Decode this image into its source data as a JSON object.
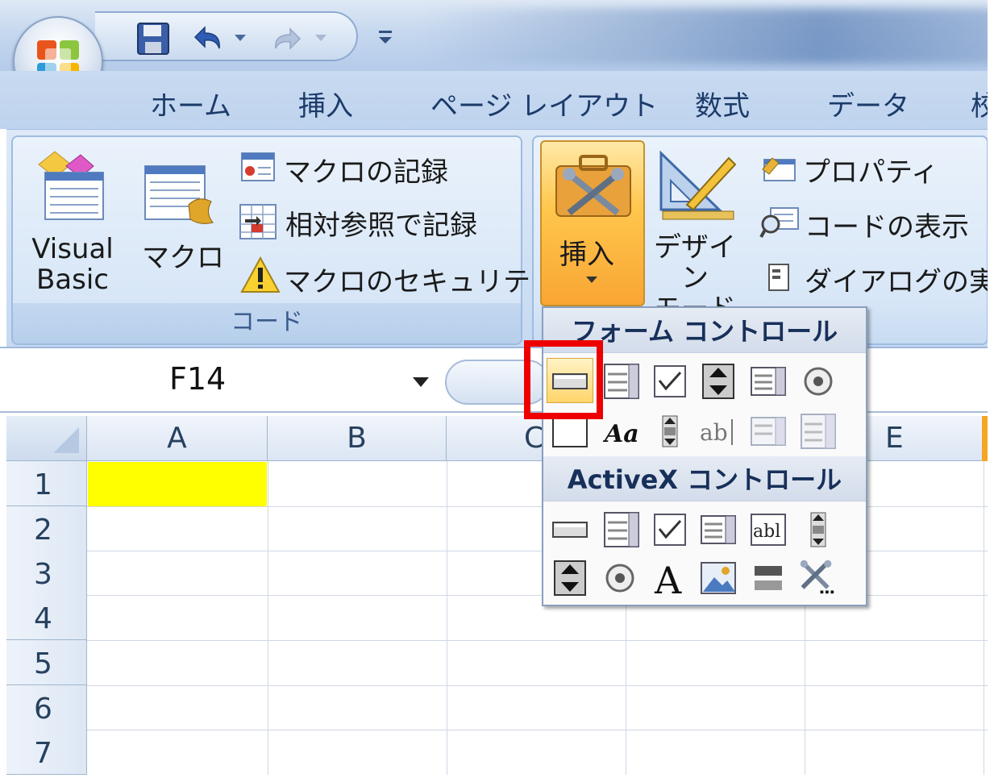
{
  "ribbon_tabs": [
    "ホーム",
    "挿入",
    "ページ レイアウト",
    "数式",
    "データ",
    "校"
  ],
  "code_group": {
    "label": "コード",
    "visual_basic": "Visual\nBasic",
    "macro": "マクロ",
    "record_macro": "マクロの記録",
    "relative_ref": "相対参照で記録",
    "macro_security": "マクロのセキュリティ"
  },
  "controls_group": {
    "insert": "挿入",
    "design_mode": "デザイン\nモード",
    "properties": "プロパティ",
    "view_code": "コードの表示",
    "run_dialog": "ダイアログの実行"
  },
  "namebox": {
    "value": "F14"
  },
  "columns": [
    "A",
    "B",
    "C",
    "D",
    "E"
  ],
  "rows": [
    "1",
    "2",
    "3",
    "4",
    "5",
    "6",
    "7"
  ],
  "insert_panel": {
    "form_controls_title": "フォーム コントロール",
    "activex_controls_title": "ActiveX コントロール",
    "form_controls": [
      [
        "button-icon",
        "combo-box-icon",
        "checkbox-icon",
        "spin-button-icon",
        "list-box-icon",
        "option-button-icon"
      ],
      [
        "group-box-icon",
        "label-icon",
        "scroll-bar-icon",
        "text-field-icon",
        "combo-list-edit-icon",
        "combo-dropdown-edit-icon"
      ]
    ],
    "activex_controls": [
      [
        "command-button-icon",
        "combo-box-icon",
        "checkbox-icon",
        "list-box-icon",
        "text-box-icon",
        "scroll-bar-icon"
      ],
      [
        "spin-button-icon",
        "option-button-icon",
        "label-icon",
        "image-icon",
        "toggle-button-icon",
        "more-controls-icon"
      ]
    ]
  },
  "colors": {
    "selected_cell_fill": "#ffff00",
    "highlight_box": "#ee0000"
  }
}
